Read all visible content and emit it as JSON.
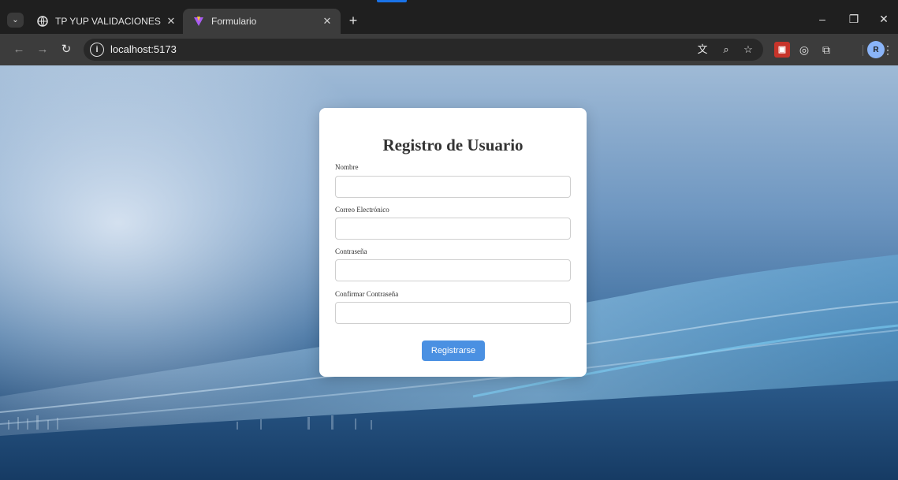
{
  "browser": {
    "tabs": [
      {
        "title": "TP YUP VALIDACIONES",
        "icon": "globe-icon",
        "active": false
      },
      {
        "title": "Formulario",
        "icon": "vite-icon",
        "active": true
      }
    ],
    "url": "localhost:5173",
    "profile_initial": "R"
  },
  "form": {
    "title": "Registro de Usuario",
    "fields": [
      {
        "label": "Nombre",
        "value": ""
      },
      {
        "label": "Correo Electrónico",
        "value": ""
      },
      {
        "label": "Contraseña",
        "value": ""
      },
      {
        "label": "Confirmar Contraseña",
        "value": ""
      }
    ],
    "submit_label": "Registrarse",
    "accent_color": "#4a90e2"
  }
}
